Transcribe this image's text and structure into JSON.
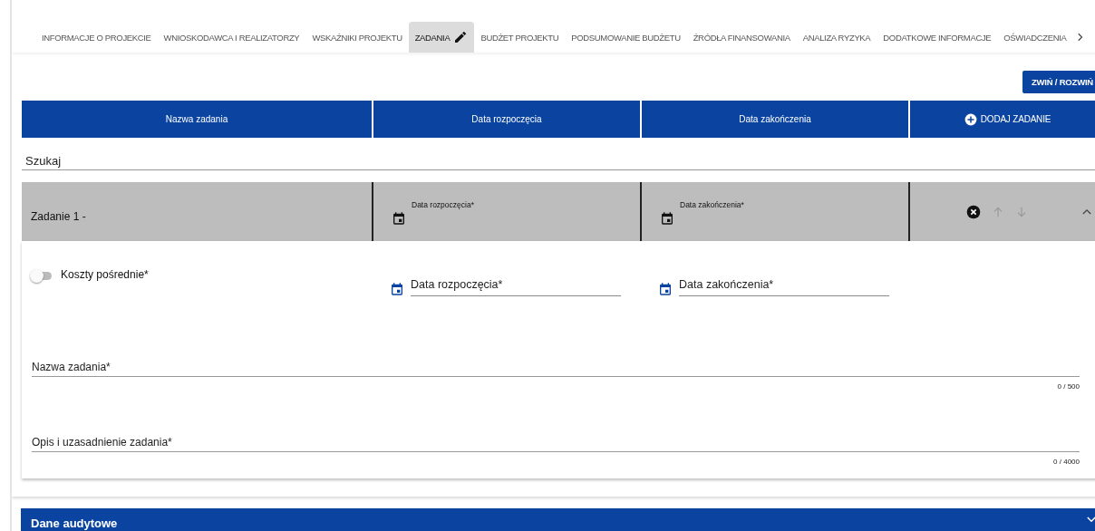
{
  "tabs": [
    {
      "label": "INFORMACJE O PROJEKCIE",
      "selected": false
    },
    {
      "label": "WNIOSKODAWCA I REALIZATORZY",
      "selected": false
    },
    {
      "label": "WSKAŹNIKI PROJEKTU",
      "selected": false
    },
    {
      "label": "ZADANIA",
      "selected": true
    },
    {
      "label": "BUDŻET PROJEKTU",
      "selected": false
    },
    {
      "label": "PODSUMOWANIE BUDŻETU",
      "selected": false
    },
    {
      "label": "ŹRÓDŁA FINANSOWANIA",
      "selected": false
    },
    {
      "label": "ANALIZA RYZYKA",
      "selected": false
    },
    {
      "label": "DODATKOWE INFORMACJE",
      "selected": false
    },
    {
      "label": "OŚWIADCZENIA",
      "selected": false
    }
  ],
  "collapse_button": "ZWIŃ / ROZWIŃ",
  "table": {
    "columns": [
      "Nazwa zadania",
      "Data rozpoczęcia",
      "Data zakończenia"
    ],
    "add_button": "DODAJ ZADANIE"
  },
  "search": {
    "placeholder": "Szukaj"
  },
  "task": {
    "name": "Zadanie 1 -",
    "start_label": "Data rozpoczęcia*",
    "end_label": "Data zakończenia*",
    "move_up_disabled": true,
    "move_down_disabled": true,
    "expanded": true,
    "details": {
      "indirect_costs": {
        "label": "Koszty pośrednie*",
        "on": false
      },
      "start_date": {
        "placeholder": "Data rozpoczęcia*"
      },
      "end_date": {
        "placeholder": "Data zakończenia*"
      },
      "name_field": {
        "placeholder": "Nazwa zadania*",
        "counter": "0 / 500"
      },
      "description_field": {
        "placeholder": "Opis i uzasadnienie zadania*",
        "counter": "0 / 4000"
      }
    }
  },
  "audit_section": {
    "title": "Dane audytowe",
    "expanded": false
  }
}
